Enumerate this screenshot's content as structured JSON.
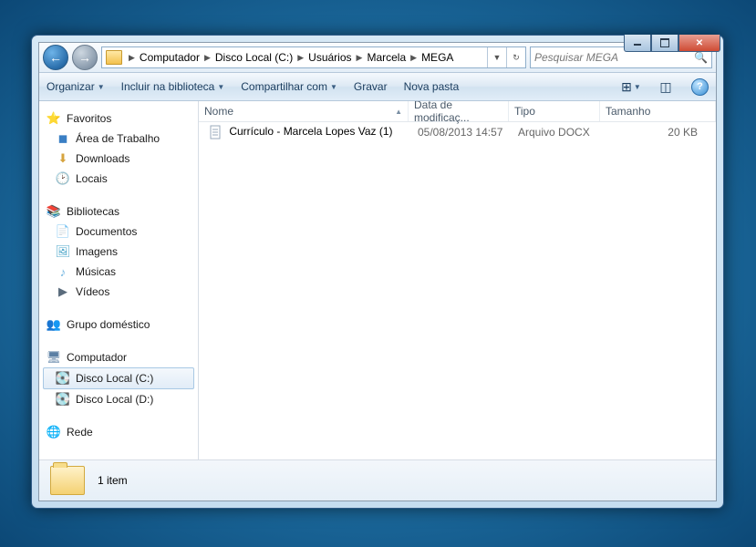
{
  "titlebar": {
    "min": "",
    "max": "",
    "close": ""
  },
  "nav": {
    "breadcrumbs": [
      "Computador",
      "Disco Local (C:)",
      "Usuários",
      "Marcela",
      "MEGA"
    ],
    "search_placeholder": "Pesquisar MEGA"
  },
  "toolbar": {
    "organize": "Organizar",
    "include": "Incluir na biblioteca",
    "share": "Compartilhar com",
    "burn": "Gravar",
    "newfolder": "Nova pasta"
  },
  "sidebar": {
    "favorites": {
      "label": "Favoritos",
      "items": [
        "Área de Trabalho",
        "Downloads",
        "Locais"
      ]
    },
    "libraries": {
      "label": "Bibliotecas",
      "items": [
        "Documentos",
        "Imagens",
        "Músicas",
        "Vídeos"
      ]
    },
    "homegroup": {
      "label": "Grupo doméstico"
    },
    "computer": {
      "label": "Computador",
      "items": [
        "Disco Local (C:)",
        "Disco Local (D:)"
      ],
      "selected": 0
    },
    "network": {
      "label": "Rede"
    }
  },
  "columns": {
    "name": "Nome",
    "date": "Data de modificaç...",
    "type": "Tipo",
    "size": "Tamanho"
  },
  "files": [
    {
      "name": "Currículo - Marcela Lopes Vaz (1)",
      "date": "05/08/2013 14:57",
      "type": "Arquivo DOCX",
      "size": "20 KB"
    }
  ],
  "status": {
    "count": "1 item"
  }
}
